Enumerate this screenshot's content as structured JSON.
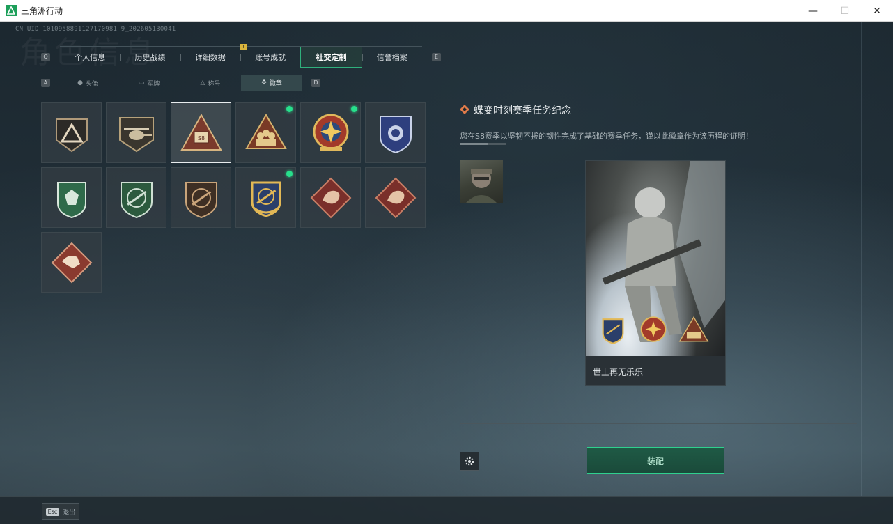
{
  "window": {
    "title": "三角洲行动",
    "min": "—",
    "max": "☐",
    "close": "✕"
  },
  "uid": "CN UID 1010958891127170981 9_202605130041",
  "watermark": "角色信息",
  "main_tabs": {
    "prev_key": "Q",
    "next_key": "E",
    "items": [
      {
        "label": "个人信息"
      },
      {
        "label": "历史战绩"
      },
      {
        "label": "详细数据"
      },
      {
        "label": "账号成就",
        "badge": "!"
      },
      {
        "label": "社交定制",
        "active": true
      },
      {
        "label": "信誉档案"
      }
    ]
  },
  "sub_tabs": {
    "prev_key": "A",
    "next_key": "D",
    "items": [
      {
        "label": "头像",
        "icon": "person-icon"
      },
      {
        "label": "军牌",
        "icon": "dogtag-icon"
      },
      {
        "label": "称号",
        "icon": "title-icon"
      },
      {
        "label": "徽章",
        "icon": "badge-icon",
        "active": true
      }
    ]
  },
  "badges": [
    {
      "name": "triangle-emblem-badge",
      "new": false
    },
    {
      "name": "helicopter-badge",
      "new": false
    },
    {
      "name": "s8-season-badge",
      "new": false,
      "selected": true
    },
    {
      "name": "squad-triangle-badge",
      "new": true
    },
    {
      "name": "star-compass-badge",
      "new": true
    },
    {
      "name": "blue-shield-badge",
      "new": false
    },
    {
      "name": "green-gem-shield-badge",
      "new": false
    },
    {
      "name": "green-rifle-badge",
      "new": false
    },
    {
      "name": "bronze-rifle-badge",
      "new": false
    },
    {
      "name": "gold-rifle-shield-badge",
      "new": true
    },
    {
      "name": "red-dragon-badge-1",
      "new": false
    },
    {
      "name": "red-dragon-badge-2",
      "new": false
    },
    {
      "name": "runner-badge",
      "new": false
    }
  ],
  "detail": {
    "title": "蝶变时刻赛季任务纪念",
    "description": "您在S8赛季以坚韧不拔的韧性完成了基础的赛季任务，谨以此徽章作为该历程的证明！",
    "card_name": "世上再无乐乐",
    "equip_label": "装配"
  },
  "footer": {
    "esc_key": "Esc",
    "esc_label": "退出"
  },
  "colors": {
    "accent": "#2fd08e",
    "new_dot": "#27e08c",
    "gold": "#c9a45a",
    "red_badge": "#7a2f2a"
  }
}
